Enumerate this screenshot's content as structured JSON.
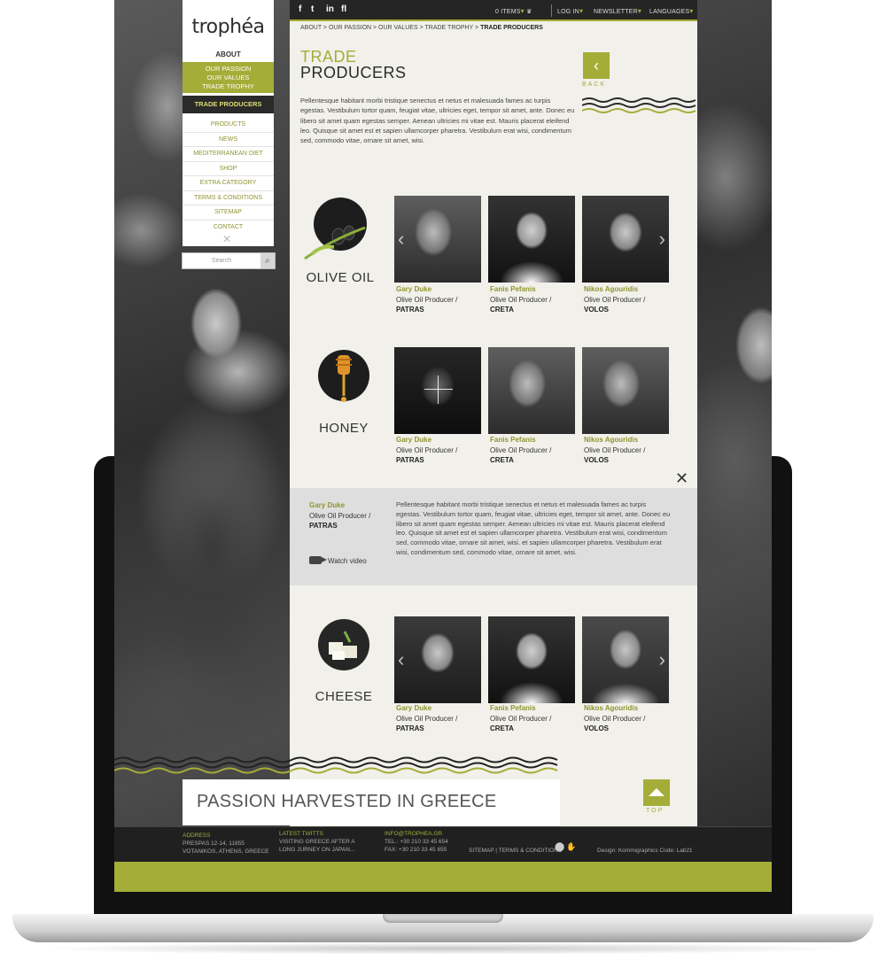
{
  "topbar": {
    "social": [
      "f",
      "t",
      "in",
      "fl"
    ],
    "items_label": "0 ITEMS",
    "login": "LOG IN",
    "newsletter": "NEWSLETTER",
    "languages": "LANGUAGES"
  },
  "nav": {
    "logo": "trophéa",
    "about": "ABOUT",
    "sub": [
      "OUR PASSION",
      "OUR VALUES",
      "TRADE TROPHY"
    ],
    "active": "TRADE PRODUCERS",
    "items": [
      "PRODUCTS",
      "NEWS",
      "MEDITERRANEAN DIET",
      "SHOP",
      "EXTRA CATEGORY",
      "TERMS & CONDITIONS",
      "SITEMAP",
      "CONTACT"
    ],
    "close": "✕",
    "search_placeholder": "Search"
  },
  "breadcrumb": {
    "path": "ABOUT > OUR PASSION > OUR VALUES > TRADE TROPHY > ",
    "current": "TRADE PRODUCERS"
  },
  "heading": {
    "line1": "TRADE",
    "line2": "PRODUCERS"
  },
  "back_label": "BACK",
  "intro": "Pellentesque habitant morbi tristique senectus et netus et malesuada fames ac turpis egestas. Vestibulum tortor quam, feugiat vitae, ultricies eget, tempor sit amet, ante. Donec eu libero sit amet quam egestas semper. Aenean ultricies mi vitae est. Mauris placerat eleifend leo. Quisque sit amet est et sapien ullamcorper pharetra. Vestibulum erat wisi, condimentum sed, commodo vitae, ornare sit amet, wisi.",
  "categories": [
    {
      "label": "OLIVE OIL",
      "producers": [
        {
          "name": "Gary Duke",
          "role": "Olive Oil Producer /",
          "city": "PATRAS"
        },
        {
          "name": "Fanis Pefanis",
          "role": "Olive Oil Producer /",
          "city": "CRETA"
        },
        {
          "name": "Nikos Agouridis",
          "role": "Olive Oil Producer /",
          "city": "VOLOS"
        }
      ]
    },
    {
      "label": "HONEY",
      "producers": [
        {
          "name": "Gary Duke",
          "role": "Olive Oil Producer /",
          "city": "PATRAS"
        },
        {
          "name": "Fanis Pefanis",
          "role": "Olive Oil Producer /",
          "city": "CRETA"
        },
        {
          "name": "Nikos Agouridis",
          "role": "Olive Oil Producer /",
          "city": "VOLOS"
        }
      ]
    },
    {
      "label": "CHEESE",
      "producers": [
        {
          "name": "Gary Duke",
          "role": "Olive Oil Producer /",
          "city": "PATRAS"
        },
        {
          "name": "Fanis Pefanis",
          "role": "Olive Oil Producer /",
          "city": "CRETA"
        },
        {
          "name": "Nikos Agouridis",
          "role": "Olive Oil Producer /",
          "city": "VOLOS"
        }
      ]
    }
  ],
  "detail": {
    "name": "Gary Duke",
    "role": "Olive Oil Producer /",
    "city": "PATRAS",
    "text": "Pellentesque habitant morbi tristique senectus et netus et malesuada fames ac turpis egestas. Vestibulum tortor quam, feugiat vitae, ultricies eget, tempor sit amet, ante. Donec eu libero sit amet quam egestas semper. Aenean ultricies mi vitae est. Mauris placerat eleifend leo. Quisque sit amet est et sapien ullamcorper pharetra. Vestibulum erat wisi, condimentum sed, commodo vitae, ornare sit amet, wisi. et sapien ullamcorper pharetra. Vestibulum erat wisi, condimentum sed, commodo vitae, ornare sit amet, wisi.",
    "watch_video": "Watch video",
    "close": "✕"
  },
  "slogan": "PASSION HARVESTED IN GREECE",
  "top_label": "TOP",
  "footer": {
    "address_label": "ADDRESS",
    "address_line1": "PRESPAS 12-14, 11855",
    "address_line2": "VOTANIKOS, ATHENS, GREECE",
    "twitts_label": "LATEST TWITTS",
    "twitt_line1": "VISITING GREECE AFTER A",
    "twitt_line2": "LONG JURNEY ON JAPAN...",
    "email": "INFO@TROPHEA.GR",
    "tel": "TEL.: +30 210 33 45 654",
    "fax": "FAX: +30 210 33 45 655",
    "links": "SITEMAP  |  TERMS & CONDITIONS",
    "credits": "Design: Kommigraphics  Code: Lab21"
  },
  "colors": {
    "accent": "#a4ad37",
    "dark": "#252525",
    "panel": "#f1f0ea"
  }
}
